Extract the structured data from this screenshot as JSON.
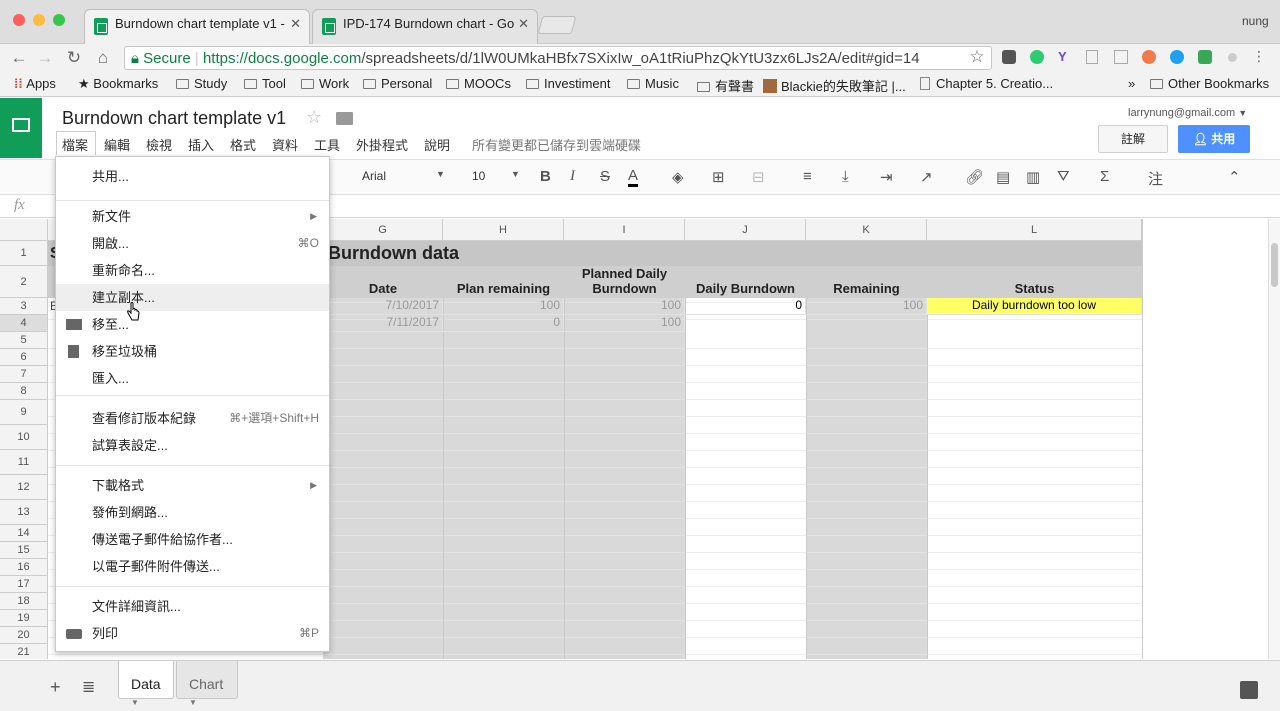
{
  "browser": {
    "user": "nung",
    "tabs": [
      {
        "title": "Burndown chart template v1 -",
        "active": true
      },
      {
        "title": "IPD-174 Burndown chart - Go",
        "active": false
      }
    ],
    "omnibox": {
      "secure_label": "Secure",
      "url_host": "https://docs.google.com",
      "url_path": "/spreadsheets/d/1lW0UMkaHBfx7SXixIw_oA1tRiuPhzQkYtU3zx6LJs2A/edit#gid=14"
    },
    "bookmarks": [
      "Apps",
      "Bookmarks",
      "Study",
      "Tool",
      "Work",
      "Personal",
      "MOOCs",
      "Investiment",
      "Music",
      "有聲書",
      "Blackie的失敗筆記 |...",
      "Chapter 5. Creatio..."
    ],
    "other_bookmarks": "Other Bookmarks",
    "overflow": "»"
  },
  "doc": {
    "title": "Burndown chart template v1",
    "menus": [
      "檔案",
      "編輯",
      "檢視",
      "插入",
      "格式",
      "資料",
      "工具",
      "外掛程式",
      "說明"
    ],
    "save_status": "所有變更都已儲存到雲端硬碟",
    "account": "larrynung@gmail.com",
    "comment_label": "註解",
    "share_label": "共用",
    "fx": "fx"
  },
  "toolbar": {
    "font": "Arial",
    "size": "10",
    "bold": "B",
    "italic": "I",
    "strike": "S",
    "textcolor": "A",
    "more": "注"
  },
  "grid": {
    "columns": [
      "G",
      "H",
      "I",
      "J",
      "K",
      "L"
    ],
    "rows": [
      "1",
      "2",
      "3",
      "4",
      "5",
      "6",
      "7",
      "8",
      "9",
      "10",
      "11",
      "12",
      "13",
      "14",
      "15",
      "16",
      "17",
      "18",
      "19",
      "20",
      "21"
    ],
    "section_title": "Burndown data",
    "headers": [
      "Date",
      "Plan remaining",
      "Planned Daily Burndown",
      "Daily Burndown",
      "Remaining",
      "Status"
    ],
    "data": [
      [
        "7/10/2017",
        "100",
        "100",
        "0",
        "100",
        "Daily burndown too low"
      ],
      [
        "7/11/2017",
        "0",
        "100",
        "",
        "",
        ""
      ]
    ],
    "status_color": "#ffff66"
  },
  "file_menu": {
    "items": [
      {
        "label": "共用...",
        "shortcut": ""
      },
      {
        "label": "新文件",
        "shortcut": "",
        "submenu": true
      },
      {
        "label": "開啟...",
        "shortcut": "⌘O"
      },
      {
        "label": "重新命名...",
        "shortcut": ""
      },
      {
        "label": "建立副本...",
        "shortcut": "",
        "hover": true
      },
      {
        "label": "移至...",
        "shortcut": ""
      },
      {
        "label": "移至垃圾桶",
        "shortcut": ""
      },
      {
        "label": "匯入...",
        "shortcut": ""
      },
      {
        "label": "查看修訂版本紀錄",
        "shortcut": "⌘+選項+Shift+H"
      },
      {
        "label": "試算表設定...",
        "shortcut": ""
      },
      {
        "label": "下載格式",
        "shortcut": "",
        "submenu": true
      },
      {
        "label": "發佈到網路...",
        "shortcut": ""
      },
      {
        "label": "傳送電子郵件給協作者...",
        "shortcut": ""
      },
      {
        "label": "以電子郵件附件傳送...",
        "shortcut": ""
      },
      {
        "label": "文件詳細資訊...",
        "shortcut": ""
      },
      {
        "label": "列印",
        "shortcut": "⌘P"
      }
    ]
  },
  "sheets": {
    "tabs": [
      "Data",
      "Chart"
    ],
    "active": "Data"
  }
}
